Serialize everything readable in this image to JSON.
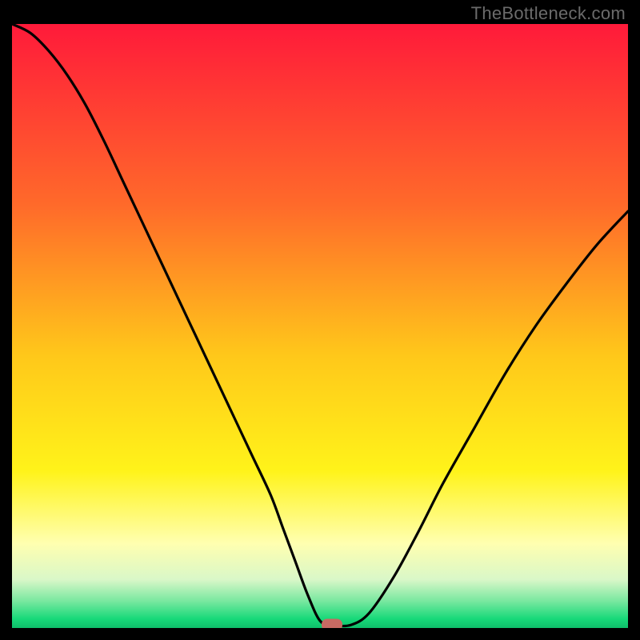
{
  "watermark": "TheBottleneck.com",
  "colors": {
    "red": "#ff1a3a",
    "orange": "#ff9a1a",
    "yellow": "#ffe81a",
    "paleyellow": "#ffffb0",
    "mint": "#9ff0b8",
    "green": "#17d979",
    "bg": "#000000",
    "curve": "#000000",
    "marker": "#c76a63"
  },
  "chart_data": {
    "type": "line",
    "title": "",
    "xlabel": "",
    "ylabel": "",
    "xlim": [
      0,
      100
    ],
    "ylim": [
      0,
      100
    ],
    "series": [
      {
        "name": "bottleneck-curve",
        "x": [
          0,
          3,
          6,
          9,
          12,
          15,
          18,
          21,
          24,
          27,
          30,
          33,
          36,
          39,
          42,
          44,
          46,
          48,
          50,
          52,
          55,
          58,
          62,
          66,
          70,
          75,
          80,
          85,
          90,
          95,
          100
        ],
        "y": [
          100,
          98.5,
          95.5,
          91.5,
          86.5,
          80.5,
          74,
          67.5,
          61,
          54.5,
          48,
          41.5,
          35,
          28.5,
          22,
          16.5,
          11,
          5.5,
          1.2,
          0.5,
          0.5,
          2.5,
          8.5,
          16,
          24,
          33,
          42,
          50,
          57,
          63.5,
          69
        ]
      }
    ],
    "annotations": [
      {
        "name": "min-marker",
        "x": 52,
        "y": 0.5
      }
    ],
    "background_gradient_stops": [
      {
        "offset": 0.0,
        "color": "#ff1a3a"
      },
      {
        "offset": 0.3,
        "color": "#ff6a2a"
      },
      {
        "offset": 0.55,
        "color": "#ffc81a"
      },
      {
        "offset": 0.74,
        "color": "#fff31a"
      },
      {
        "offset": 0.86,
        "color": "#ffffb0"
      },
      {
        "offset": 0.92,
        "color": "#d9f7c8"
      },
      {
        "offset": 0.955,
        "color": "#7ae8a0"
      },
      {
        "offset": 0.985,
        "color": "#17d979"
      },
      {
        "offset": 1.0,
        "color": "#0fbf6a"
      }
    ]
  }
}
